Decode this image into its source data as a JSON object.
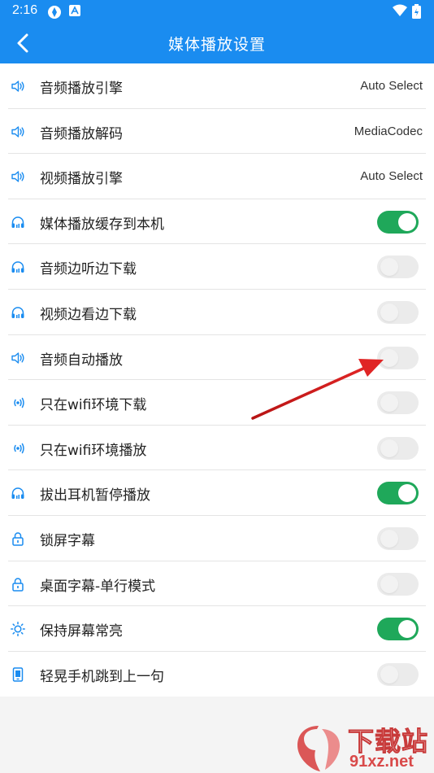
{
  "status_bar": {
    "time": "2:16"
  },
  "header": {
    "title": "媒体播放设置"
  },
  "settings": [
    {
      "label": "音频播放引擎",
      "icon": "speaker-icon",
      "value": "Auto Select"
    },
    {
      "label": "音频播放解码",
      "icon": "speaker-icon",
      "value": "MediaCodec"
    },
    {
      "label": "视频播放引擎",
      "icon": "speaker-icon",
      "value": "Auto Select"
    },
    {
      "label": "媒体播放缓存到本机",
      "icon": "headphones-icon",
      "toggle": true
    },
    {
      "label": "音频边听边下载",
      "icon": "headphones-icon",
      "toggle": false
    },
    {
      "label": "视频边看边下载",
      "icon": "headphones-icon",
      "toggle": false
    },
    {
      "label": "音频自动播放",
      "icon": "speaker-icon",
      "toggle": false
    },
    {
      "label": "只在wifi环境下载",
      "icon": "wifi-signal-icon",
      "toggle": false
    },
    {
      "label": "只在wifi环境播放",
      "icon": "wifi-signal-icon",
      "toggle": false
    },
    {
      "label": "拔出耳机暂停播放",
      "icon": "headphones-icon",
      "toggle": true
    },
    {
      "label": "锁屏字幕",
      "icon": "lock-icon",
      "toggle": false
    },
    {
      "label": "桌面字幕-单行模式",
      "icon": "lock-icon",
      "toggle": false
    },
    {
      "label": "保持屏幕常亮",
      "icon": "sun-icon",
      "toggle": true
    },
    {
      "label": "轻晃手机跳到上一句",
      "icon": "phone-icon",
      "toggle": false
    }
  ],
  "watermark": {
    "brand": "下载站",
    "domain": "91xz.net"
  },
  "colors": {
    "accent": "#1a8cf0",
    "toggle_on": "#1fa85a",
    "annotation_arrow": "#d61f1f"
  }
}
